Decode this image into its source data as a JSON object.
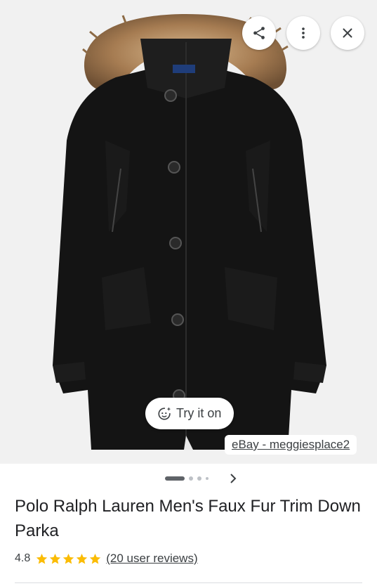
{
  "image": {
    "label_logo_text": "POLO RALPH LAUREN"
  },
  "actions": {
    "share_icon": "share-icon",
    "more_icon": "more-vert-icon",
    "close_icon": "close-icon"
  },
  "try_on": {
    "icon": "face-sparkle-icon",
    "label": "Try it on"
  },
  "source": {
    "label": "eBay - meggiesplace2"
  },
  "carousel": {
    "total_dots": 4,
    "active_index": 0
  },
  "product": {
    "title": "Polo Ralph Lauren Men's Faux Fur Trim Down Parka",
    "rating": "4.8",
    "stars": 5,
    "reviews_label": "(20 user reviews)"
  },
  "colors": {
    "star": "#fbbc04",
    "coat": "#141414",
    "fur": "#b08a5e"
  }
}
